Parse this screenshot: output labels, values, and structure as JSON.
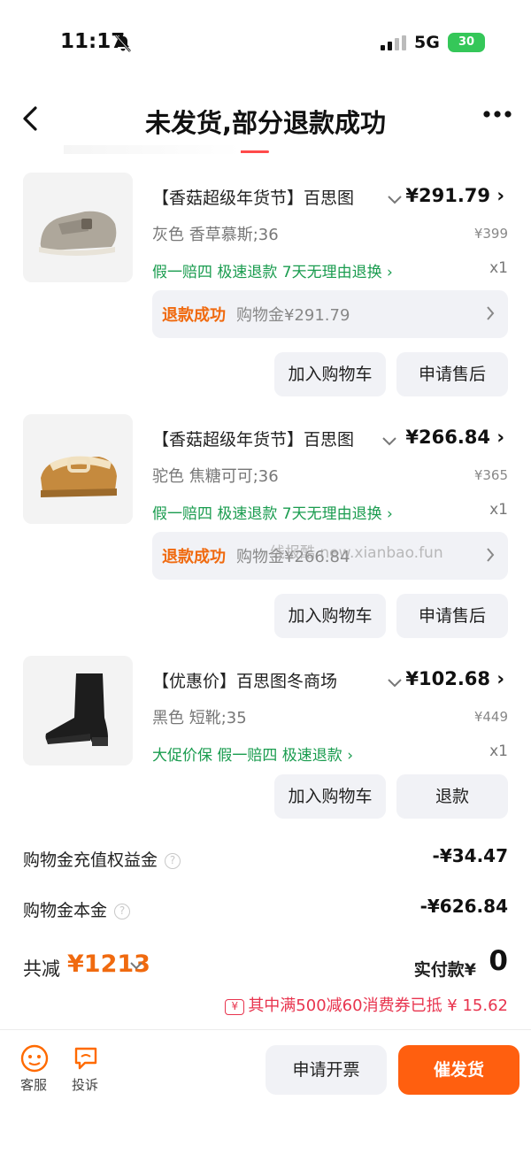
{
  "status_bar": {
    "time": "11:17",
    "network": "5G",
    "battery": "30"
  },
  "header": {
    "title": "未发货,部分退款成功"
  },
  "items": [
    {
      "title": "【香菇超级年货节】百思图",
      "price": "¥291.79",
      "sku": "灰色  香草慕斯;36",
      "original_price": "¥399",
      "tags": "假一赔四   极速退款   7天无理由退换 ›",
      "qty": "x1",
      "refund_status": "退款成功",
      "refund_amount": "购物金¥291.79",
      "btn1": "加入购物车",
      "btn2": "申请售后"
    },
    {
      "title": "【香菇超级年货节】百思图",
      "price": "¥266.84",
      "sku": "驼色  焦糖可可;36",
      "original_price": "¥365",
      "tags": "假一赔四   极速退款   7天无理由退换 ›",
      "qty": "x1",
      "refund_status": "退款成功",
      "refund_amount": "购物金¥266.84",
      "btn1": "加入购物车",
      "btn2": "申请售后"
    },
    {
      "title": "【优惠价】百思图冬商场",
      "price": "¥102.68",
      "sku": "黑色  短靴;35",
      "original_price": "¥449",
      "tags": "大促价保   假一赔四   极速退款 ›",
      "qty": "x1",
      "btn1": "加入购物车",
      "btn2": "退款"
    }
  ],
  "watermark": "线报酷 new.xianbao.fun",
  "summary": {
    "rows": [
      {
        "label": "购物金充值权益金",
        "value": "-¥34.47"
      },
      {
        "label": "购物金本金",
        "value": "-¥626.84"
      }
    ],
    "total_label": "共减",
    "total_value": "¥1213",
    "paid_label": "实付款¥",
    "paid_value": "0",
    "coupon_text": "其中满500减60消费券已抵 ¥ 15.62"
  },
  "bottom_bar": {
    "service": "客服",
    "complain": "投诉",
    "invoice": "申请开票",
    "urge": "催发货"
  },
  "colors": {
    "accent": "#ff5f0f",
    "refund": "#f06a0f",
    "green": "#1a9c4f",
    "coupon": "#e8344e"
  }
}
